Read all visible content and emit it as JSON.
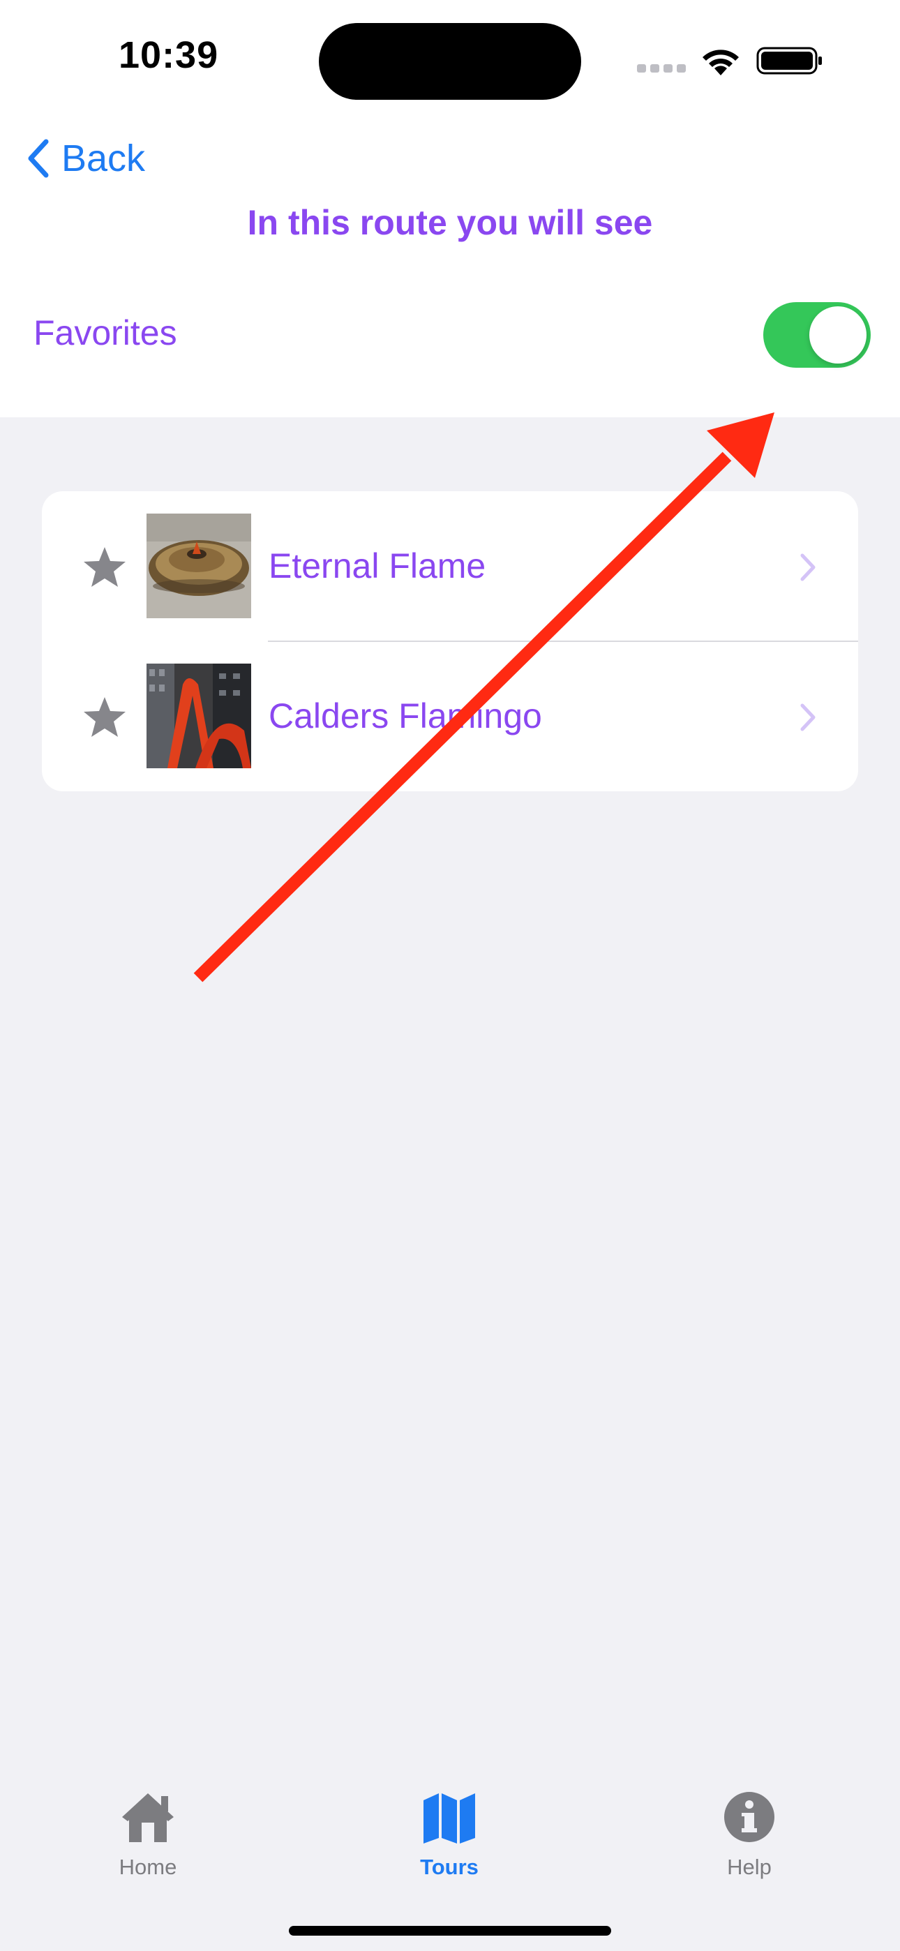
{
  "status_bar": {
    "time": "10:39"
  },
  "nav": {
    "back_label": "Back",
    "title": "In this route you will see"
  },
  "favorites": {
    "label": "Favorites",
    "enabled": true
  },
  "list": {
    "items": [
      {
        "title": "Eternal Flame",
        "starred": false
      },
      {
        "title": "Calders Flamingo",
        "starred": false
      }
    ]
  },
  "tab_bar": {
    "items": [
      {
        "label": "Home",
        "icon": "house-icon",
        "selected": false
      },
      {
        "label": "Tours",
        "icon": "map-icon",
        "selected": true
      },
      {
        "label": "Help",
        "icon": "info-icon",
        "selected": false
      }
    ]
  },
  "colors": {
    "accent_purple": "#8A47F0",
    "system_blue": "#1E7BF2",
    "toggle_green": "#34C759",
    "annotation_red": "#FF2A12",
    "background": "#F1F1F5"
  }
}
